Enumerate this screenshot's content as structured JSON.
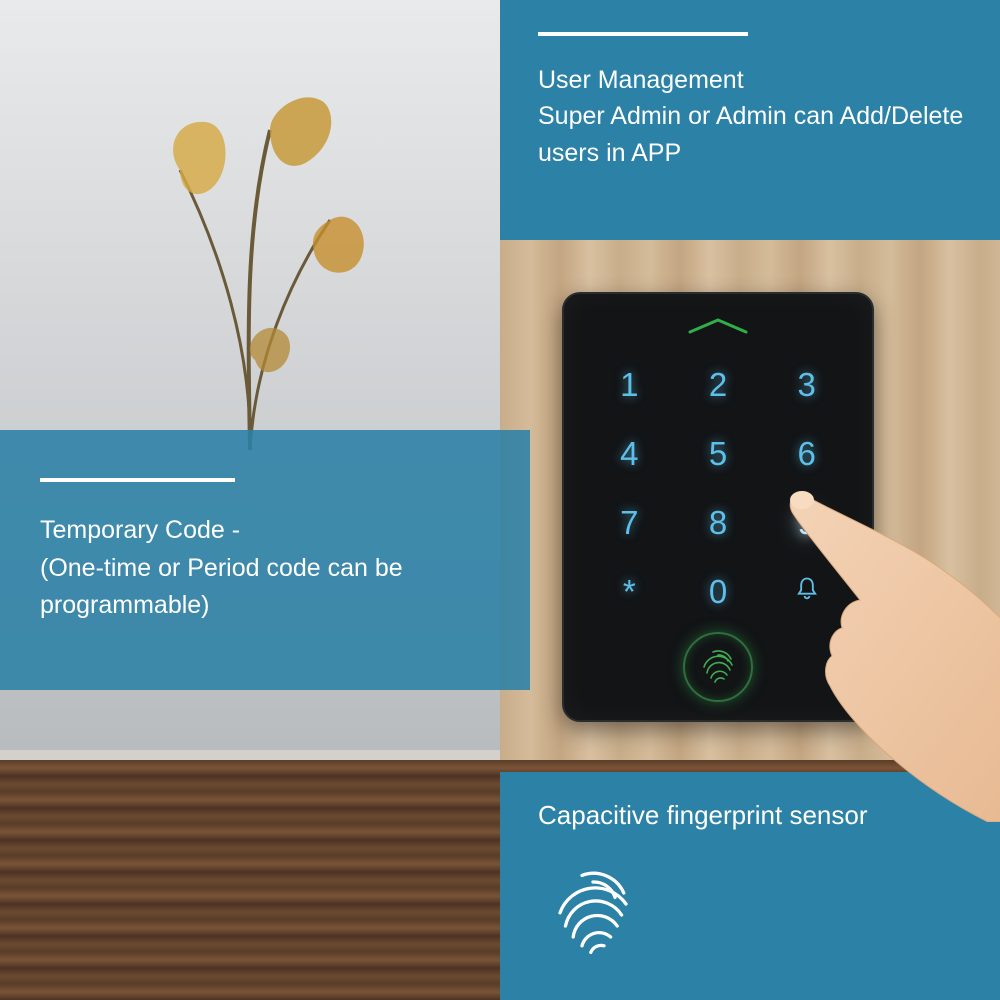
{
  "callouts": {
    "top": "User Management\nSuper Admin or Admin can Add/Delete users in APP",
    "left": "Temporary Code -\n(One-time or Period code can be programmable)",
    "bottom": "Capacitive fingerprint sensor"
  },
  "keypad": {
    "keys": [
      "1",
      "2",
      "3",
      "4",
      "5",
      "6",
      "7",
      "8",
      "9",
      "*",
      "0",
      "bell"
    ],
    "highlighted_key": "9"
  },
  "colors": {
    "panel": "#2b81a6",
    "key_glow": "#5ec0e8",
    "fp_green": "#3fae52"
  }
}
